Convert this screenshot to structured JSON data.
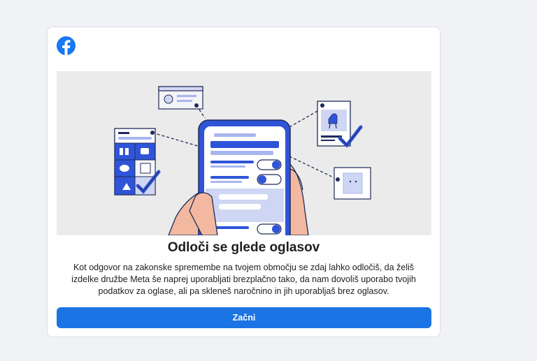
{
  "brand": {
    "logo_icon": "facebook-logo-icon",
    "color": "#1877f2"
  },
  "illustration": {
    "name": "ads-choice-illustration"
  },
  "dialog": {
    "title": "Odloči se glede oglasov",
    "description": "Kot odgovor na zakonske spremembe na tvojem območju se zdaj lahko odločiš, da želiš izdelke družbe Meta še naprej uporabljati brezplačno tako, da nam dovoliš uporabo tvojih podatkov za oglase, ali pa skleneš naročnino in jih uporabljaš brez oglasov.",
    "start_button": "Začni"
  },
  "colors": {
    "accent": "#1b74e4",
    "background": "#f0f2f5",
    "card": "#ffffff"
  }
}
